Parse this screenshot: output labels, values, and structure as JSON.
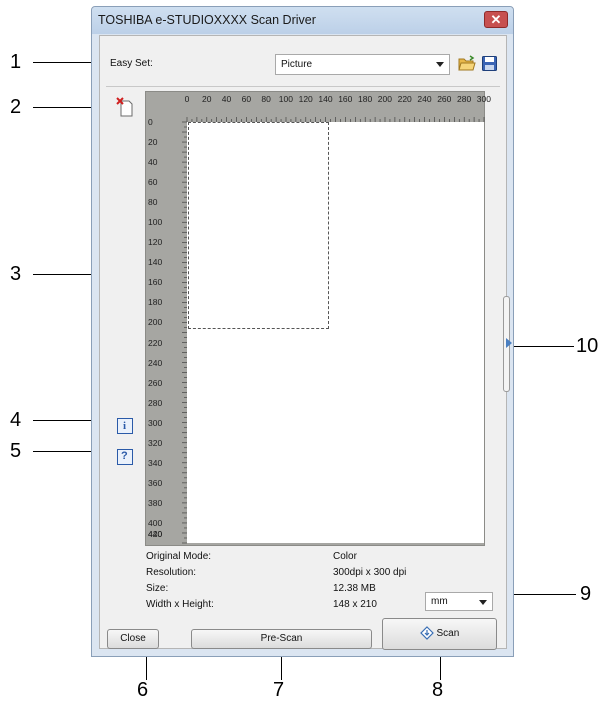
{
  "window": {
    "title": "TOSHIBA e-STUDIOXXXX Scan Driver",
    "close_glyph": "✕"
  },
  "easy_set": {
    "label": "Easy Set:",
    "selected": "Picture"
  },
  "ruler": {
    "top_ticks": [
      "0",
      "20",
      "40",
      "60",
      "80",
      "100",
      "120",
      "140",
      "160",
      "180",
      "200",
      "220",
      "240",
      "260",
      "280",
      "300"
    ],
    "left_ticks": [
      "0",
      "20",
      "40",
      "60",
      "80",
      "100",
      "120",
      "140",
      "160",
      "180",
      "200",
      "220",
      "240",
      "260",
      "280",
      "300",
      "320",
      "340",
      "360",
      "380",
      "400",
      "420",
      "440"
    ]
  },
  "info": {
    "rows": [
      {
        "label": "Original Mode:",
        "value": "Color"
      },
      {
        "label": "Resolution:",
        "value": "300dpi x 300 dpi"
      },
      {
        "label": "Size:",
        "value": "12.38 MB"
      },
      {
        "label": "Width x Height:",
        "value": "148 x 210"
      }
    ],
    "unit": "mm"
  },
  "buttons": {
    "close": "Close",
    "prescan": "Pre-Scan",
    "scan": "Scan"
  },
  "callouts": [
    "1",
    "2",
    "3",
    "4",
    "5",
    "6",
    "7",
    "8",
    "9",
    "10"
  ],
  "colors": {
    "title_bar": "#bcd0e8",
    "close_button": "#c75050",
    "ruler_bg": "#a6a6a2",
    "handle_arrow": "#4a7fc1"
  }
}
